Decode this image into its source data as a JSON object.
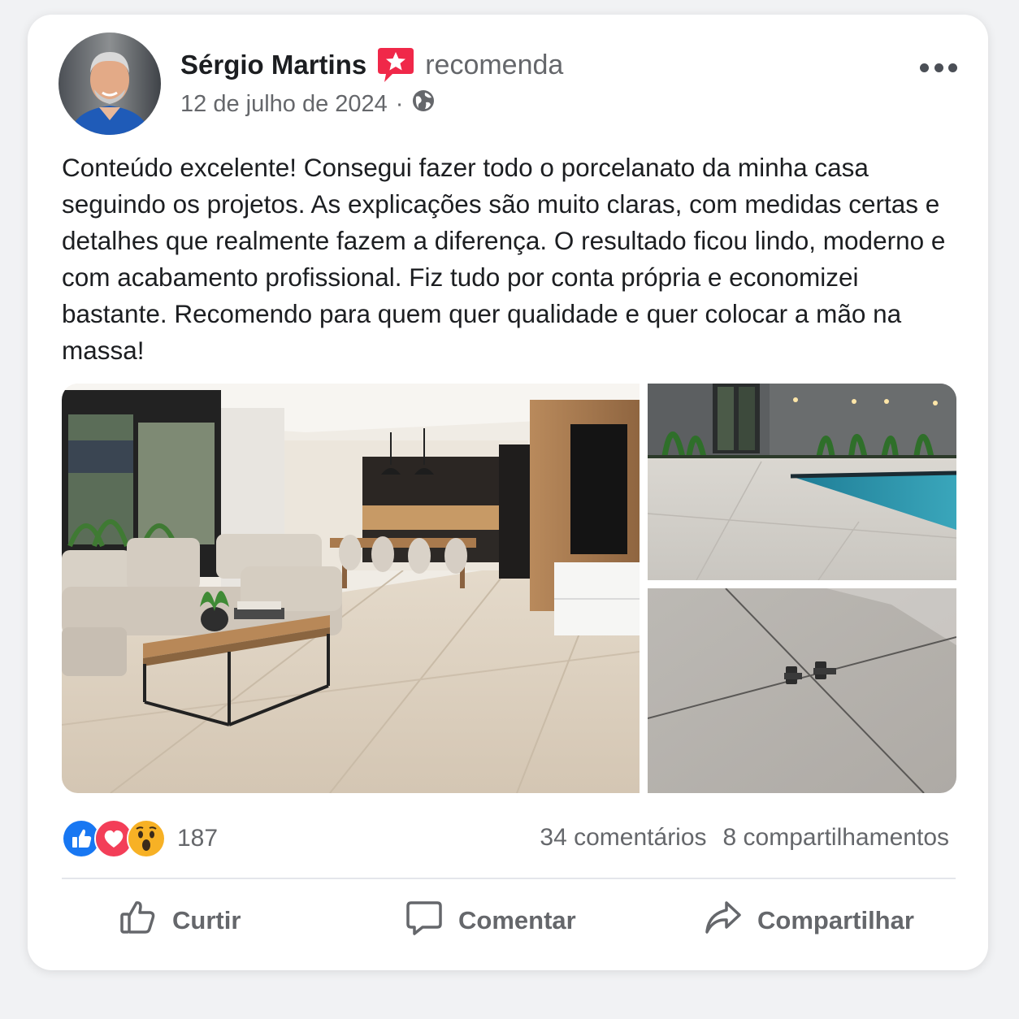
{
  "post": {
    "author": "Sérgio Martins",
    "action": "recomenda",
    "date": "12 de julho de 2024",
    "separator": "·",
    "text": "Conteúdo excelente! Consegui fazer todo o porcelanato da minha casa seguindo os projetos. As explicações são muito claras, com medidas certas e detalhes que realmente fazem a diferença. O resultado ficou lindo, moderno e com acabamento profissional. Fiz tudo por conta própria e economizei bastante. Recomendo para quem quer qualidade e quer colocar a mão na massa!",
    "photos": [
      {
        "name": "living-room-porcelain-floor-photo"
      },
      {
        "name": "pool-deck-porcelain-photo"
      },
      {
        "name": "tile-leveling-clips-photo"
      }
    ]
  },
  "engagement": {
    "reaction_icons": [
      "like-icon",
      "love-icon",
      "wow-icon"
    ],
    "reactions_count": "187",
    "comments": "34 comentários",
    "shares": "8 compartilhamentos"
  },
  "actions": {
    "like": "Curtir",
    "comment": "Comentar",
    "share": "Compartilhar"
  },
  "colors": {
    "like_blue": "#1877f2",
    "love_red": "#f33e58",
    "wow_yellow": "#f7b125",
    "recommend_badge": "#f02849",
    "muted_text": "#65676b"
  }
}
